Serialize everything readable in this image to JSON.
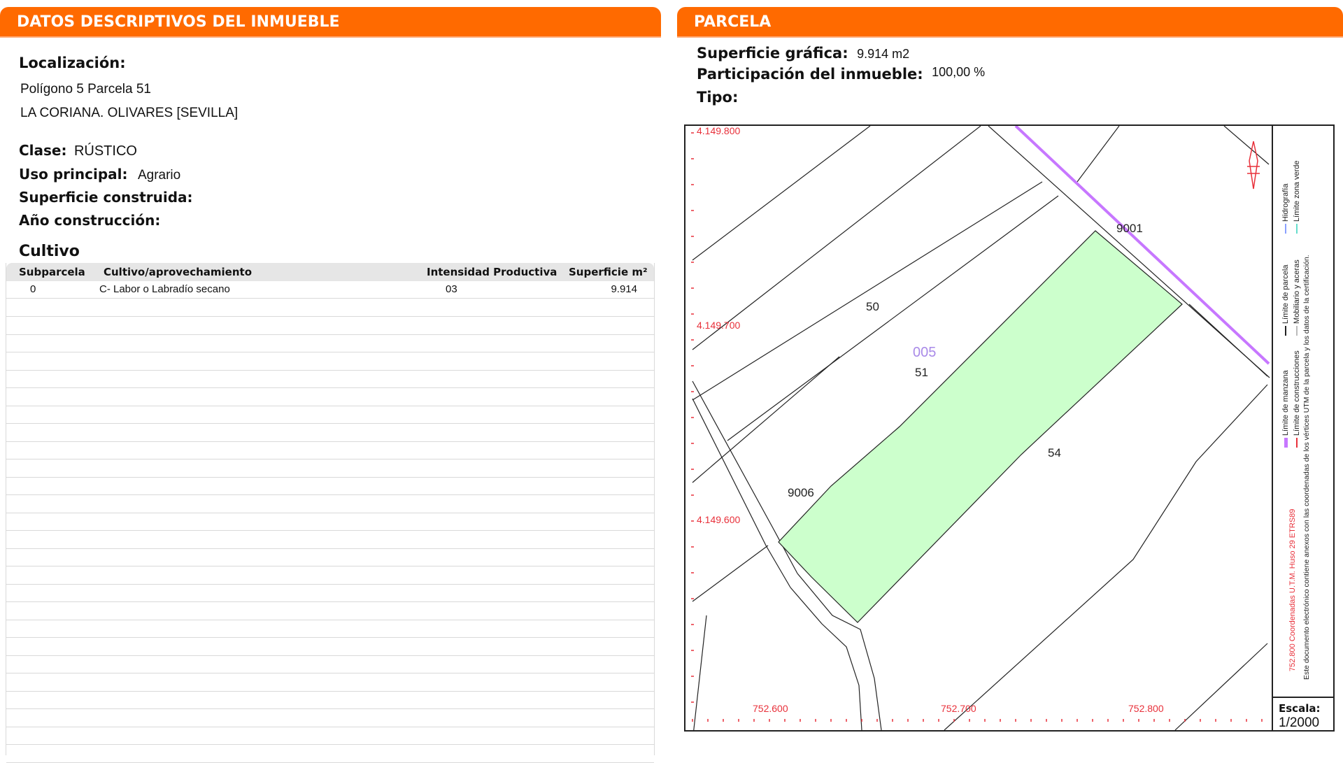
{
  "left_section": {
    "title_regular": "DATOS DESCRIPTIVOS DEL ",
    "title_bold": "INMUEBLE",
    "localizacion_label": "Localización:",
    "localizacion_line1": "Polígono 5 Parcela 51",
    "localizacion_line2": "LA CORIANA. OLIVARES [SEVILLA]",
    "clase_label": "Clase:",
    "clase_value": "RÚSTICO",
    "uso_label": "Uso principal:",
    "uso_value": "Agrario",
    "superficie_construida_label": "Superficie construida:",
    "anio_label": "Año construcción:",
    "cultivo_title": "Cultivo",
    "table": {
      "headers": [
        "Subparcela",
        "Cultivo/aprovechamiento",
        "Intensidad Productiva",
        "Superficie m²"
      ],
      "rows": [
        [
          "0",
          "C- Labor o Labradío secano",
          "03",
          "9.914"
        ]
      ]
    }
  },
  "right_section": {
    "title": "PARCELA",
    "superficie_grafica_label": "Superficie gráfica:",
    "superficie_grafica_value": "9.914 m2",
    "participacion_label": "Participación del inmueble:",
    "participacion_value": "100,00 %",
    "tipo_label": "Tipo:",
    "map": {
      "y_labels": [
        "4.149.800",
        "4.149.700",
        "4.149.600"
      ],
      "x_labels": [
        "752.600",
        "752.700",
        "752.800"
      ],
      "parcel_labels": {
        "subparcel_code": "005",
        "parcel_51": "51",
        "parcel_50": "50",
        "parcel_54": "54",
        "road_9001": "9001",
        "road_9006": "9006"
      },
      "colors": {
        "parcel_fill": "#ccffcc",
        "coordinate_red": "#e8303a",
        "hydrography_purple": "#c777ff",
        "code_purple": "#a98ae8"
      }
    },
    "legend": {
      "items": [
        "Límite de manzana",
        "Límite de construcciones",
        "Límite de parcela",
        "Mobiliario y aceras",
        "Hidrografía",
        "Límite zona verde"
      ],
      "coords_note": "752.800 Coordenadas U.T.M. Huso 29 ETRS89",
      "certificate_note": "Este documento electrónico contiene anexos con las coordenadas de los vértices UTM de la parcela y los datos de la certificación.",
      "scale_label": "Escala:",
      "scale_value": "1/2000"
    }
  }
}
